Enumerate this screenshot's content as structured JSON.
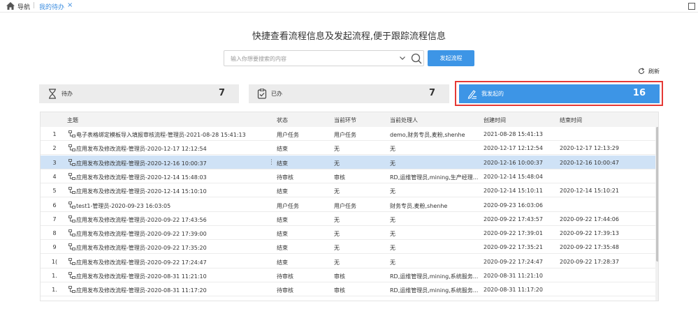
{
  "nav": {
    "home_label": "导航",
    "separator": "|",
    "active_tab": "我的待办",
    "close": "×"
  },
  "title": "快捷查看流程信息及发起流程,便于跟踪流程信息",
  "search": {
    "value": "",
    "placeholder": "输入你想要搜索的内容",
    "start_button": "发起流程"
  },
  "refresh_label": "刷新",
  "cards": [
    {
      "icon": "hourglass-icon",
      "label": "待办",
      "count": "7",
      "active": false
    },
    {
      "icon": "clipboard-check-icon",
      "label": "已办",
      "count": "7",
      "active": false
    },
    {
      "icon": "edit-doc-icon",
      "label": "我发起的",
      "count": "16",
      "active": true
    }
  ],
  "table": {
    "headers": [
      "主题",
      "状态",
      "当前环节",
      "当前处理人",
      "创建时间",
      "结束时间"
    ],
    "rows": [
      {
        "num": "1",
        "subject": "电子表格绑定模板导入填报审核流程-管理员-2021-08-28 15:41:13",
        "state": "用户任务",
        "node": "用户任务",
        "handler": "demo,财务专员,麦粉,shenhe",
        "created": "2021-08-28 15:41:13",
        "ended": ""
      },
      {
        "num": "2",
        "subject": "应用发布及修改流程-管理员-2020-12-17 12:12:54",
        "state": "结束",
        "node": "无",
        "handler": "无",
        "created": "2020-12-17 12:12:54",
        "ended": "2020-12-17 12:13:29"
      },
      {
        "num": "3",
        "subject": "应用发布及修改流程-管理员-2020-12-16 10:00:37",
        "state": "结束",
        "node": "无",
        "handler": "无",
        "created": "2020-12-16 10:00:37",
        "ended": "2020-12-16 10:00:47"
      },
      {
        "num": "4",
        "subject": "应用发布及修改流程-管理员-2020-12-14 15:48:03",
        "state": "待审核",
        "node": "审核",
        "handler": "RD,运维管理员,mining,生产经理...",
        "created": "2020-12-14 15:48:04",
        "ended": ""
      },
      {
        "num": "5",
        "subject": "应用发布及修改流程-管理员-2020-12-14 15:10:10",
        "state": "结束",
        "node": "无",
        "handler": "无",
        "created": "2020-12-14 15:10:11",
        "ended": "2020-12-14 15:10:21"
      },
      {
        "num": "6",
        "subject": "test1-管理员-2020-09-23 16:03:05",
        "state": "用户任务",
        "node": "用户任务",
        "handler": "财务专员,麦粉,shenhe",
        "created": "2020-09-23 16:03:06",
        "ended": ""
      },
      {
        "num": "7",
        "subject": "应用发布及修改流程-管理员-2020-09-22 17:43:56",
        "state": "结束",
        "node": "无",
        "handler": "无",
        "created": "2020-09-22 17:43:57",
        "ended": "2020-09-22 17:44:06"
      },
      {
        "num": "8",
        "subject": "应用发布及修改流程-管理员-2020-09-22 17:39:00",
        "state": "结束",
        "node": "无",
        "handler": "无",
        "created": "2020-09-22 17:39:01",
        "ended": "2020-09-22 17:39:13"
      },
      {
        "num": "9",
        "subject": "应用发布及修改流程-管理员-2020-09-22 17:35:20",
        "state": "结束",
        "node": "无",
        "handler": "无",
        "created": "2020-09-22 17:35:21",
        "ended": "2020-09-22 17:35:48"
      },
      {
        "num": "1(",
        "subject": "应用发布及修改流程-管理员-2020-09-22 17:24:47",
        "state": "结束",
        "node": "无",
        "handler": "无",
        "created": "2020-09-22 17:24:47",
        "ended": "2020-09-22 17:28:37"
      },
      {
        "num": "1.",
        "subject": "应用发布及修改流程-管理员-2020-08-31 11:21:10",
        "state": "待审核",
        "node": "审核",
        "handler": "RD,运维管理员,mining,系统服务...",
        "created": "2020-08-31 11:21:10",
        "ended": ""
      },
      {
        "num": "1.",
        "subject": "应用发布及修改流程-管理员-2020-08-31 11:17:20",
        "state": "待审核",
        "node": "审核",
        "handler": "RD,运维管理员,mining,系统服务...",
        "created": "2020-08-31 11:17:20",
        "ended": ""
      }
    ],
    "selected_row": 3
  },
  "colors": {
    "accent": "#3d95e6",
    "selected_row": "#cfe2f6",
    "highlight_border": "#e53935"
  }
}
